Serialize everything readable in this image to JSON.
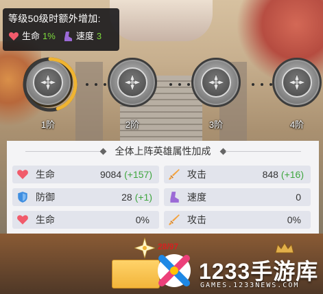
{
  "bonus": {
    "title": "等级50级时额外增加:",
    "items": [
      {
        "icon": "heart-icon",
        "label": "生命",
        "value": "1%"
      },
      {
        "icon": "boot-icon",
        "label": "速度",
        "value": "3"
      }
    ]
  },
  "tiers": [
    {
      "label": "1阶",
      "progress": 0.45
    },
    {
      "label": "2阶",
      "progress": 0
    },
    {
      "label": "3阶",
      "progress": 0
    },
    {
      "label": "4阶",
      "progress": 0
    }
  ],
  "panel": {
    "title": "全体上阵英雄属性加成",
    "stats": [
      {
        "icon": "heart-icon",
        "name": "生命",
        "value": "9084",
        "bonus": "(+157)"
      },
      {
        "icon": "sword-icon",
        "name": "攻击",
        "value": "848",
        "bonus": "(+16)"
      },
      {
        "icon": "shield-icon",
        "name": "防御",
        "value": "28",
        "bonus": "(+1)"
      },
      {
        "icon": "boot-icon",
        "name": "速度",
        "value": "0",
        "bonus": ""
      },
      {
        "icon": "heart-icon",
        "name": "生命",
        "value": "0%",
        "bonus": ""
      },
      {
        "icon": "sword-icon",
        "name": "攻击",
        "value": "0%",
        "bonus": ""
      }
    ]
  },
  "footer": {
    "count": "28/97"
  },
  "watermark": {
    "main": "1233手游库",
    "sub": "GAMES.1233NEWS.COM"
  },
  "colors": {
    "bonus_value": "#7ddc3c",
    "stat_bonus": "#3ea63e",
    "progress": "#f0b431",
    "count": "#d62020"
  }
}
